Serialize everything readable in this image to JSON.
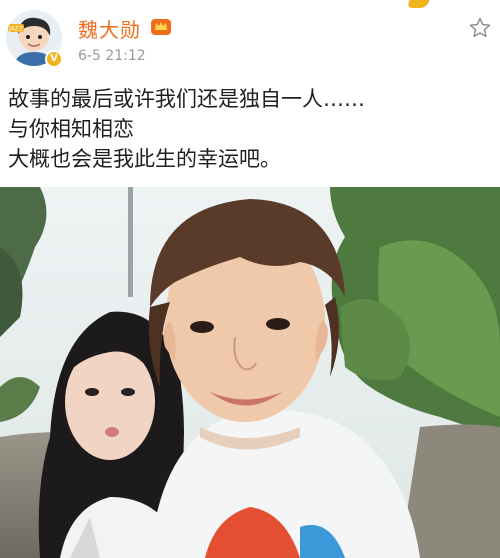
{
  "user": {
    "name": "魏大勋",
    "avatar_badge_text": "JAZZ",
    "verified_icon": "verified-v-icon",
    "vip_icon": "crown-badge-icon"
  },
  "post": {
    "timestamp": "6-5 21:12",
    "lines": [
      "故事的最后或许我们还是独自一人……",
      "与你相知相恋",
      "大概也会是我此生的幸运吧。"
    ],
    "photo_alt": "selfie-photo"
  },
  "actions": {
    "follow_icon": "star-icon"
  },
  "colors": {
    "username": "#f26d1b",
    "timestamp": "#9a9a9a",
    "accent": "#f2b31d"
  }
}
